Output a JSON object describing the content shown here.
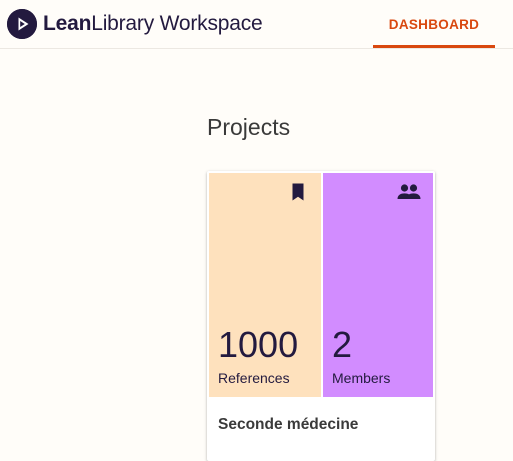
{
  "app": {
    "brand_bold": "Lean",
    "brand_regular": "Library Workspace",
    "logo_icon": "play-circle-icon",
    "accent_color": "#d9480f"
  },
  "nav": {
    "tabs": [
      {
        "label": "DASHBOARD",
        "active": true
      }
    ]
  },
  "main": {
    "title": "Projects",
    "projects": [
      {
        "name": "Seconde médecine",
        "references": {
          "value": "1000",
          "label": "References",
          "icon": "bookmark-icon",
          "color": "#fee1bd"
        },
        "members": {
          "value": "2",
          "label": "Members",
          "icon": "people-icon",
          "color": "#d28cff"
        }
      }
    ]
  }
}
